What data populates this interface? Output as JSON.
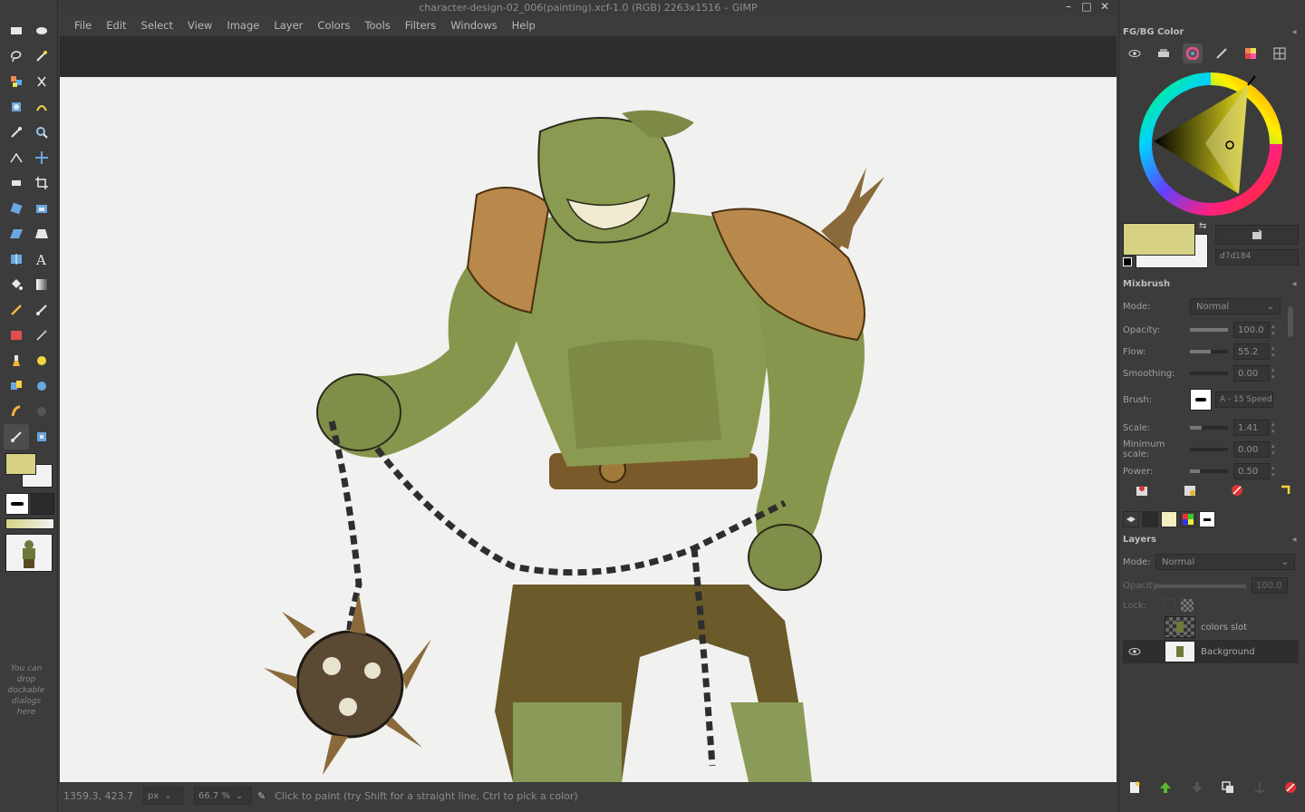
{
  "window": {
    "title": "character-design-02_006(painting).xcf-1.0 (RGB) 2263x1516 – GIMP",
    "min": "–",
    "max": "□",
    "close": "✕",
    "menu": "⌄"
  },
  "menubar": [
    "File",
    "Edit",
    "Select",
    "View",
    "Image",
    "Layer",
    "Colors",
    "Tools",
    "Filters",
    "Windows",
    "Help"
  ],
  "toolbox": {
    "drop_hint": "You can drop dockable dialogs here",
    "fg_color": "#d7d184",
    "bg_color": "#f2f2f2"
  },
  "status": {
    "coords": "1359.3, 423.7",
    "unit": "px",
    "zoom": "66.7 %",
    "message": "Click to paint (try Shift for a straight line, Ctrl to pick a color)"
  },
  "fgbg_panel": {
    "title": "FG/BG Color",
    "hex": "d7d184",
    "fg_color": "#d7d184"
  },
  "mixbrush": {
    "title": "Mixbrush",
    "mode_label": "Mode:",
    "mode_value": "Normal",
    "rows": [
      {
        "label": "Opacity:",
        "value": "100.0",
        "fill": 1.0
      },
      {
        "label": "Flow:",
        "value": "55.2",
        "fill": 0.55
      },
      {
        "label": "Smoothing:",
        "value": "0.00",
        "fill": 0.0
      },
      {
        "label": "Brush:",
        "value": "A - 15 Speed"
      },
      {
        "label": "Scale:",
        "value": "1.41",
        "fill": 0.3
      },
      {
        "label": "Minimum scale:",
        "value": "0.00",
        "fill": 0.0
      },
      {
        "label": "Power:",
        "value": "0.50",
        "fill": 0.25
      }
    ]
  },
  "layers_panel": {
    "title": "Layers",
    "mode_label": "Mode:",
    "mode_value": "Normal",
    "opacity_label": "Opacity",
    "opacity_value": "100.0",
    "lock_label": "Lock:",
    "layers": [
      {
        "name": "colors slot",
        "visible": false,
        "selected": false
      },
      {
        "name": "Background",
        "visible": true,
        "selected": true
      }
    ]
  }
}
